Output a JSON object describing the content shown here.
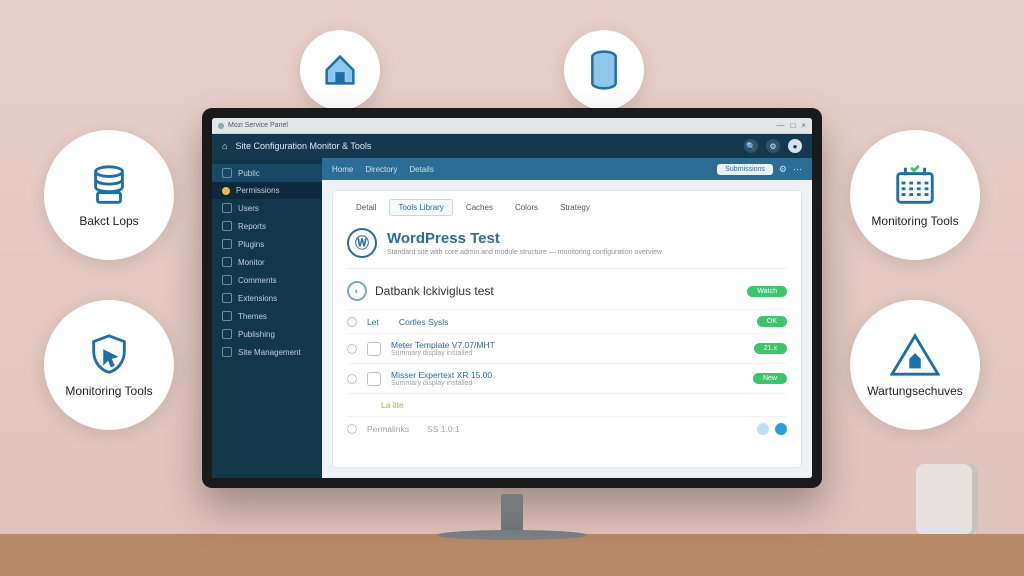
{
  "bubbles": {
    "backups": "Bakct Lops",
    "monitoring_left": "Monitoring Tools",
    "monitoring_right": "Monitoring Tools",
    "maintenance": "Wartungsechuves"
  },
  "chrome": {
    "tab_title": "Mozi Service Panel",
    "win": [
      "—",
      "□",
      "×"
    ]
  },
  "urlbar": {
    "icon": "⌂",
    "title": "Site Configuration Monitor & Tools"
  },
  "sidebar": {
    "top": "Public",
    "active": "Permissions",
    "items": [
      "Users",
      "Reports",
      "Plugins",
      "Monitor",
      "Comments",
      "Extensions",
      "Themes",
      "Publishing",
      "Site Management"
    ]
  },
  "tabs": {
    "items": [
      "Home",
      "Directory",
      "Details"
    ],
    "button": "Submissions"
  },
  "subtabs": [
    "Detail",
    "Tools Library",
    "Caches",
    "Colors",
    "Strategy"
  ],
  "site": {
    "name": "WordPress Test",
    "desc": "Standard site with core admin and module structure — monitoring configuration overview"
  },
  "section": {
    "title": "Datbank lckiviglus test",
    "badge": "Watch"
  },
  "rows": [
    {
      "kind": "head",
      "icon": "",
      "t1": "Let",
      "t2": "Cortles Sysls",
      "pill": "OK"
    },
    {
      "kind": "item",
      "t1": "Meter Template V7.07/MHT",
      "t2": "Summary display installed",
      "pill": "21.x"
    },
    {
      "kind": "item",
      "t1": "Misser Expertext XR 15.00",
      "t2": "Summary display installed",
      "pill": "New"
    },
    {
      "kind": "link",
      "t1": "La lite"
    },
    {
      "kind": "foot",
      "t1": "Permalinks",
      "t2": "SS 1.0:1"
    }
  ]
}
